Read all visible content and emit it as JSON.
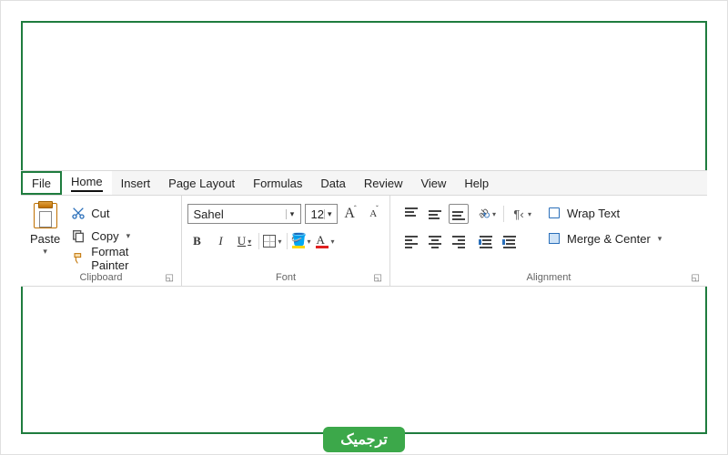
{
  "tabs": {
    "file": "File",
    "home": "Home",
    "insert": "Insert",
    "pagelayout": "Page Layout",
    "formulas": "Formulas",
    "data": "Data",
    "review": "Review",
    "view": "View",
    "help": "Help"
  },
  "clipboard": {
    "paste": "Paste",
    "cut": "Cut",
    "copy": "Copy",
    "format_painter": "Format Painter",
    "group_label": "Clipboard"
  },
  "font": {
    "font_name": "Sahel",
    "font_size": "12",
    "group_label": "Font"
  },
  "alignment": {
    "wrap_text": "Wrap Text",
    "merge_center": "Merge & Center",
    "group_label": "Alignment"
  },
  "watermark": "ترجمیک"
}
